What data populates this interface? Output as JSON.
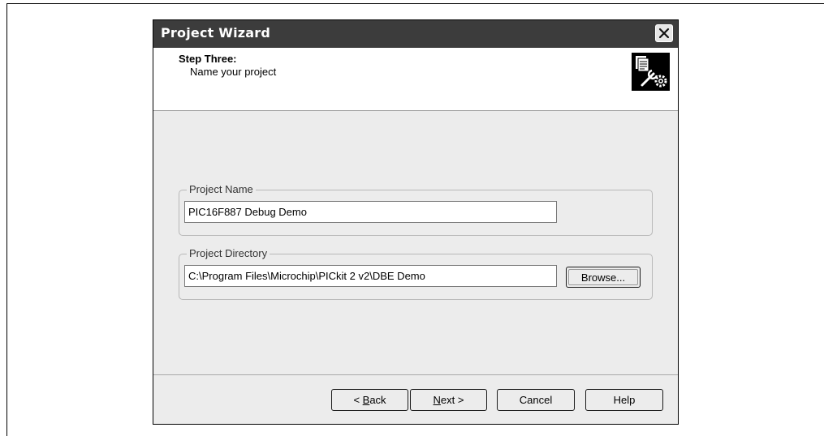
{
  "window": {
    "title": "Project Wizard"
  },
  "header": {
    "step": "Step Three:",
    "subtitle": "Name your project",
    "icon": "wizard-settings-icon"
  },
  "project_name": {
    "label": "Project Name",
    "value": "PIC16F887 Debug Demo"
  },
  "project_directory": {
    "label": "Project Directory",
    "value": "C:\\Program Files\\Microchip\\PICkit 2 v2\\DBE Demo",
    "browse_label": "Browse..."
  },
  "footer": {
    "back": {
      "prefix": "< ",
      "accel": "B",
      "rest": "ack"
    },
    "next": {
      "accel": "N",
      "rest": "ext >"
    },
    "cancel_label": "Cancel",
    "help_label": "Help"
  }
}
